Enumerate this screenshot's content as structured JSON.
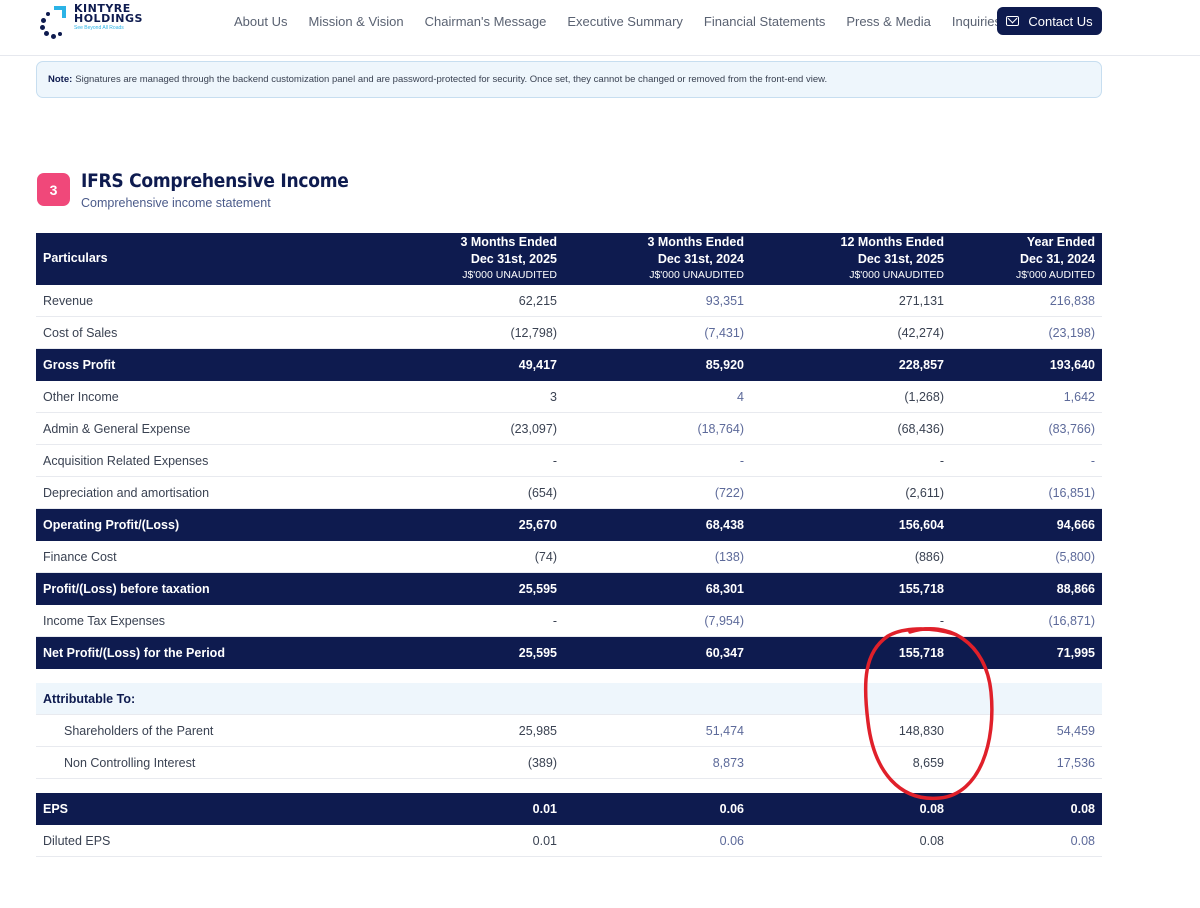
{
  "brand": {
    "line1": "KINTYRE",
    "line2": "HOLDINGS",
    "tagline": "See Beyond All Roads"
  },
  "nav": {
    "items": [
      "About Us",
      "Mission & Vision",
      "Chairman's Message",
      "Executive Summary",
      "Financial Statements",
      "Press & Media",
      "Inquiries"
    ],
    "contact_label": "Contact Us"
  },
  "note": {
    "label": "Note:",
    "text": "Signatures are managed through the backend customization panel and are password-protected for security. Once set, they cannot be changed or removed from the front-end view."
  },
  "section": {
    "number": "3",
    "title": "IFRS Comprehensive Income",
    "subtitle": "Comprehensive income statement"
  },
  "table": {
    "header_label": "Particulars",
    "columns": [
      {
        "line1": "3 Months Ended",
        "line2": "Dec 31st, 2025",
        "unit": "J$'000 UNAUDITED"
      },
      {
        "line1": "3 Months Ended",
        "line2": "Dec 31st, 2024",
        "unit": "J$'000 UNAUDITED"
      },
      {
        "line1": "12 Months Ended",
        "line2": "Dec 31st, 2025",
        "unit": "J$'000 UNAUDITED"
      },
      {
        "line1": "Year Ended",
        "line2": "Dec 31, 2024",
        "unit": "J$'000 AUDITED"
      }
    ],
    "rows": [
      {
        "label": "Revenue",
        "v": [
          "62,215",
          "93,351",
          "271,131",
          "216,838"
        ]
      },
      {
        "label": "Cost of Sales",
        "v": [
          "(12,798)",
          "(7,431)",
          "(42,274)",
          "(23,198)"
        ]
      },
      {
        "label": "Gross Profit",
        "v": [
          "49,417",
          "85,920",
          "228,857",
          "193,640"
        ]
      },
      {
        "label": "Other Income",
        "v": [
          "3",
          "4",
          "(1,268)",
          "1,642"
        ]
      },
      {
        "label": "Admin & General Expense",
        "v": [
          "(23,097)",
          "(18,764)",
          "(68,436)",
          "(83,766)"
        ]
      },
      {
        "label": "Acquisition Related Expenses",
        "v": [
          "-",
          "-",
          "-",
          "-"
        ]
      },
      {
        "label": "Depreciation and amortisation",
        "v": [
          "(654)",
          "(722)",
          "(2,611)",
          "(16,851)"
        ]
      },
      {
        "label": "Operating Profit/(Loss)",
        "v": [
          "25,670",
          "68,438",
          "156,604",
          "94,666"
        ]
      },
      {
        "label": "Finance Cost",
        "v": [
          "(74)",
          "(138)",
          "(886)",
          "(5,800)"
        ]
      },
      {
        "label": "Profit/(Loss) before taxation",
        "v": [
          "25,595",
          "68,301",
          "155,718",
          "88,866"
        ]
      },
      {
        "label": "Income Tax Expenses",
        "v": [
          "-",
          "(7,954)",
          "-",
          "(16,871)"
        ]
      },
      {
        "label": "Net Profit/(Loss) for the Period",
        "v": [
          "25,595",
          "60,347",
          "155,718",
          "71,995"
        ]
      },
      {
        "label": "Attributable To:",
        "v": [
          "",
          "",
          "",
          ""
        ]
      },
      {
        "label": "Shareholders of the Parent",
        "v": [
          "25,985",
          "51,474",
          "148,830",
          "54,459"
        ]
      },
      {
        "label": "Non Controlling Interest",
        "v": [
          "(389)",
          "8,873",
          "8,659",
          "17,536"
        ]
      },
      {
        "label": "EPS",
        "v": [
          "0.01",
          "0.06",
          "0.08",
          "0.08"
        ]
      },
      {
        "label": "Diluted EPS",
        "v": [
          "0.01",
          "0.06",
          "0.08",
          "0.08"
        ]
      }
    ]
  },
  "colors": {
    "navy": "#0e1b4f",
    "accent_pink": "#f0487a",
    "annotation_red": "#e0202a",
    "note_bg": "#eef6fc"
  }
}
